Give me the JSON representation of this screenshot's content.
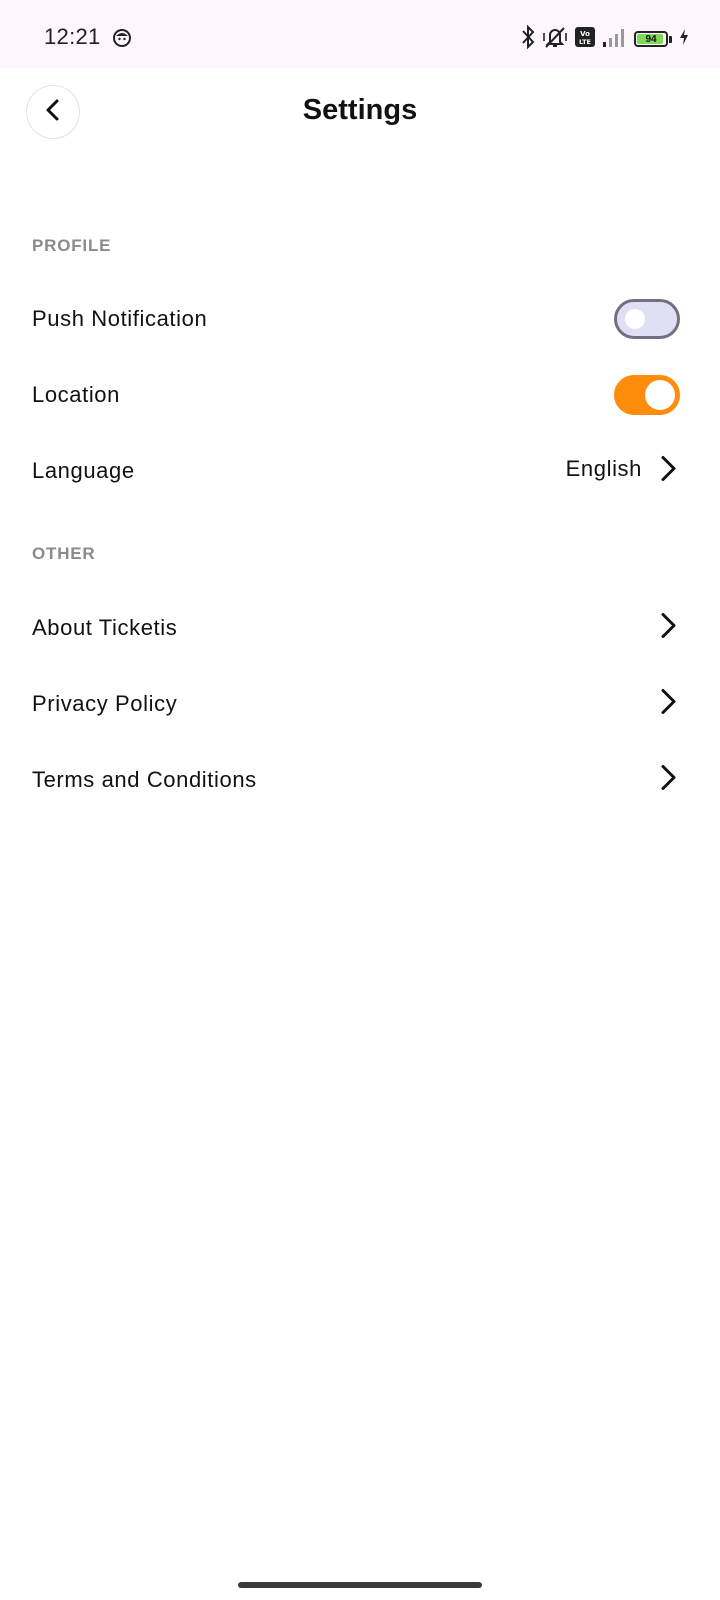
{
  "status_bar": {
    "time": "12:21",
    "battery_level": "94",
    "battery_fraction": 0.94,
    "icons": [
      "bluetooth-icon",
      "vibrate-off-icon",
      "volte-icon",
      "signal-icon",
      "battery-icon",
      "charging-icon"
    ]
  },
  "header": {
    "title": "Settings",
    "back_icon": "chevron-left-icon"
  },
  "sections": {
    "profile": {
      "title": "PROFILE",
      "push_notification": {
        "label": "Push Notification",
        "enabled": false
      },
      "location": {
        "label": "Location",
        "enabled": true
      },
      "language": {
        "label": "Language",
        "value": "English"
      }
    },
    "other": {
      "title": "OTHER",
      "about": {
        "label": "About Ticketis"
      },
      "privacy": {
        "label": "Privacy Policy"
      },
      "terms": {
        "label": "Terms and Conditions"
      }
    }
  },
  "colors": {
    "accent": "#FF8C0A",
    "toggle_off_track": "#DFE0F4",
    "section_title": "#8A8A8A"
  }
}
